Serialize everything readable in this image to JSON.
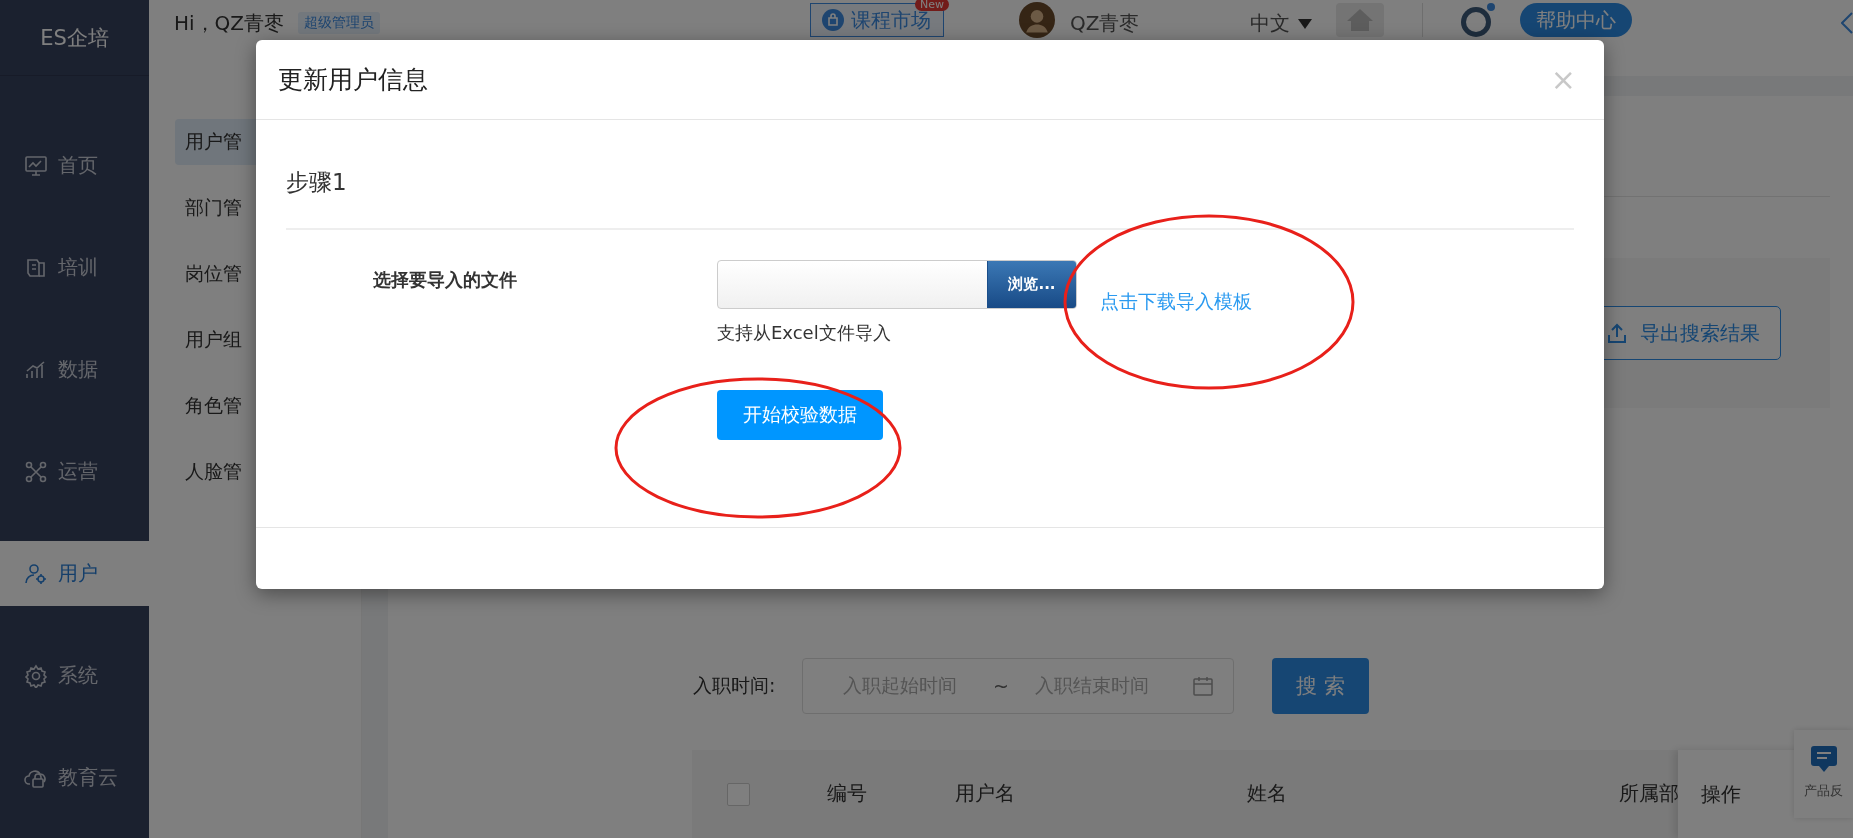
{
  "sidebar": {
    "logo": "ES企培",
    "items": [
      {
        "label": "首页",
        "selected": false
      },
      {
        "label": "培训",
        "selected": false
      },
      {
        "label": "数据",
        "selected": false
      },
      {
        "label": "运营",
        "selected": false
      },
      {
        "label": "用户",
        "selected": true
      },
      {
        "label": "系统",
        "selected": false
      },
      {
        "label": "教育云",
        "selected": false
      }
    ]
  },
  "topbar": {
    "greeting": "Hi，QZ青枣",
    "role_badge": "超级管理员",
    "course_market": {
      "label": "课程市场",
      "badge": "New"
    },
    "username": "QZ青枣",
    "language": "中文",
    "help": "帮助中心"
  },
  "submenu": {
    "items": [
      {
        "label": "用户管",
        "selected": true
      },
      {
        "label": "部门管",
        "selected": false
      },
      {
        "label": "岗位管",
        "selected": false
      },
      {
        "label": "用户组",
        "selected": false
      },
      {
        "label": "角色管",
        "selected": false
      },
      {
        "label": "人脸管",
        "selected": false
      }
    ]
  },
  "toolbar": {
    "export": "导出搜索结果"
  },
  "filters": {
    "hire_date_label": "入职时间:",
    "start_placeholder": "入职起始时间",
    "separator": "~",
    "end_placeholder": "入职结束时间",
    "search": "搜 索"
  },
  "table": {
    "select_all": {
      "checked": false
    },
    "columns": [
      "编号",
      "用户名",
      "姓名",
      "所属部"
    ],
    "action_column": "操作"
  },
  "feedback": "产品反",
  "modal": {
    "title": "更新用户信息",
    "close": "×",
    "step": "步骤1",
    "file_label": "选择要导入的文件",
    "browse": "浏览...",
    "hint": "支持从Excel文件导入",
    "template_link": "点击下载导入模板",
    "validate": "开始校验数据"
  }
}
